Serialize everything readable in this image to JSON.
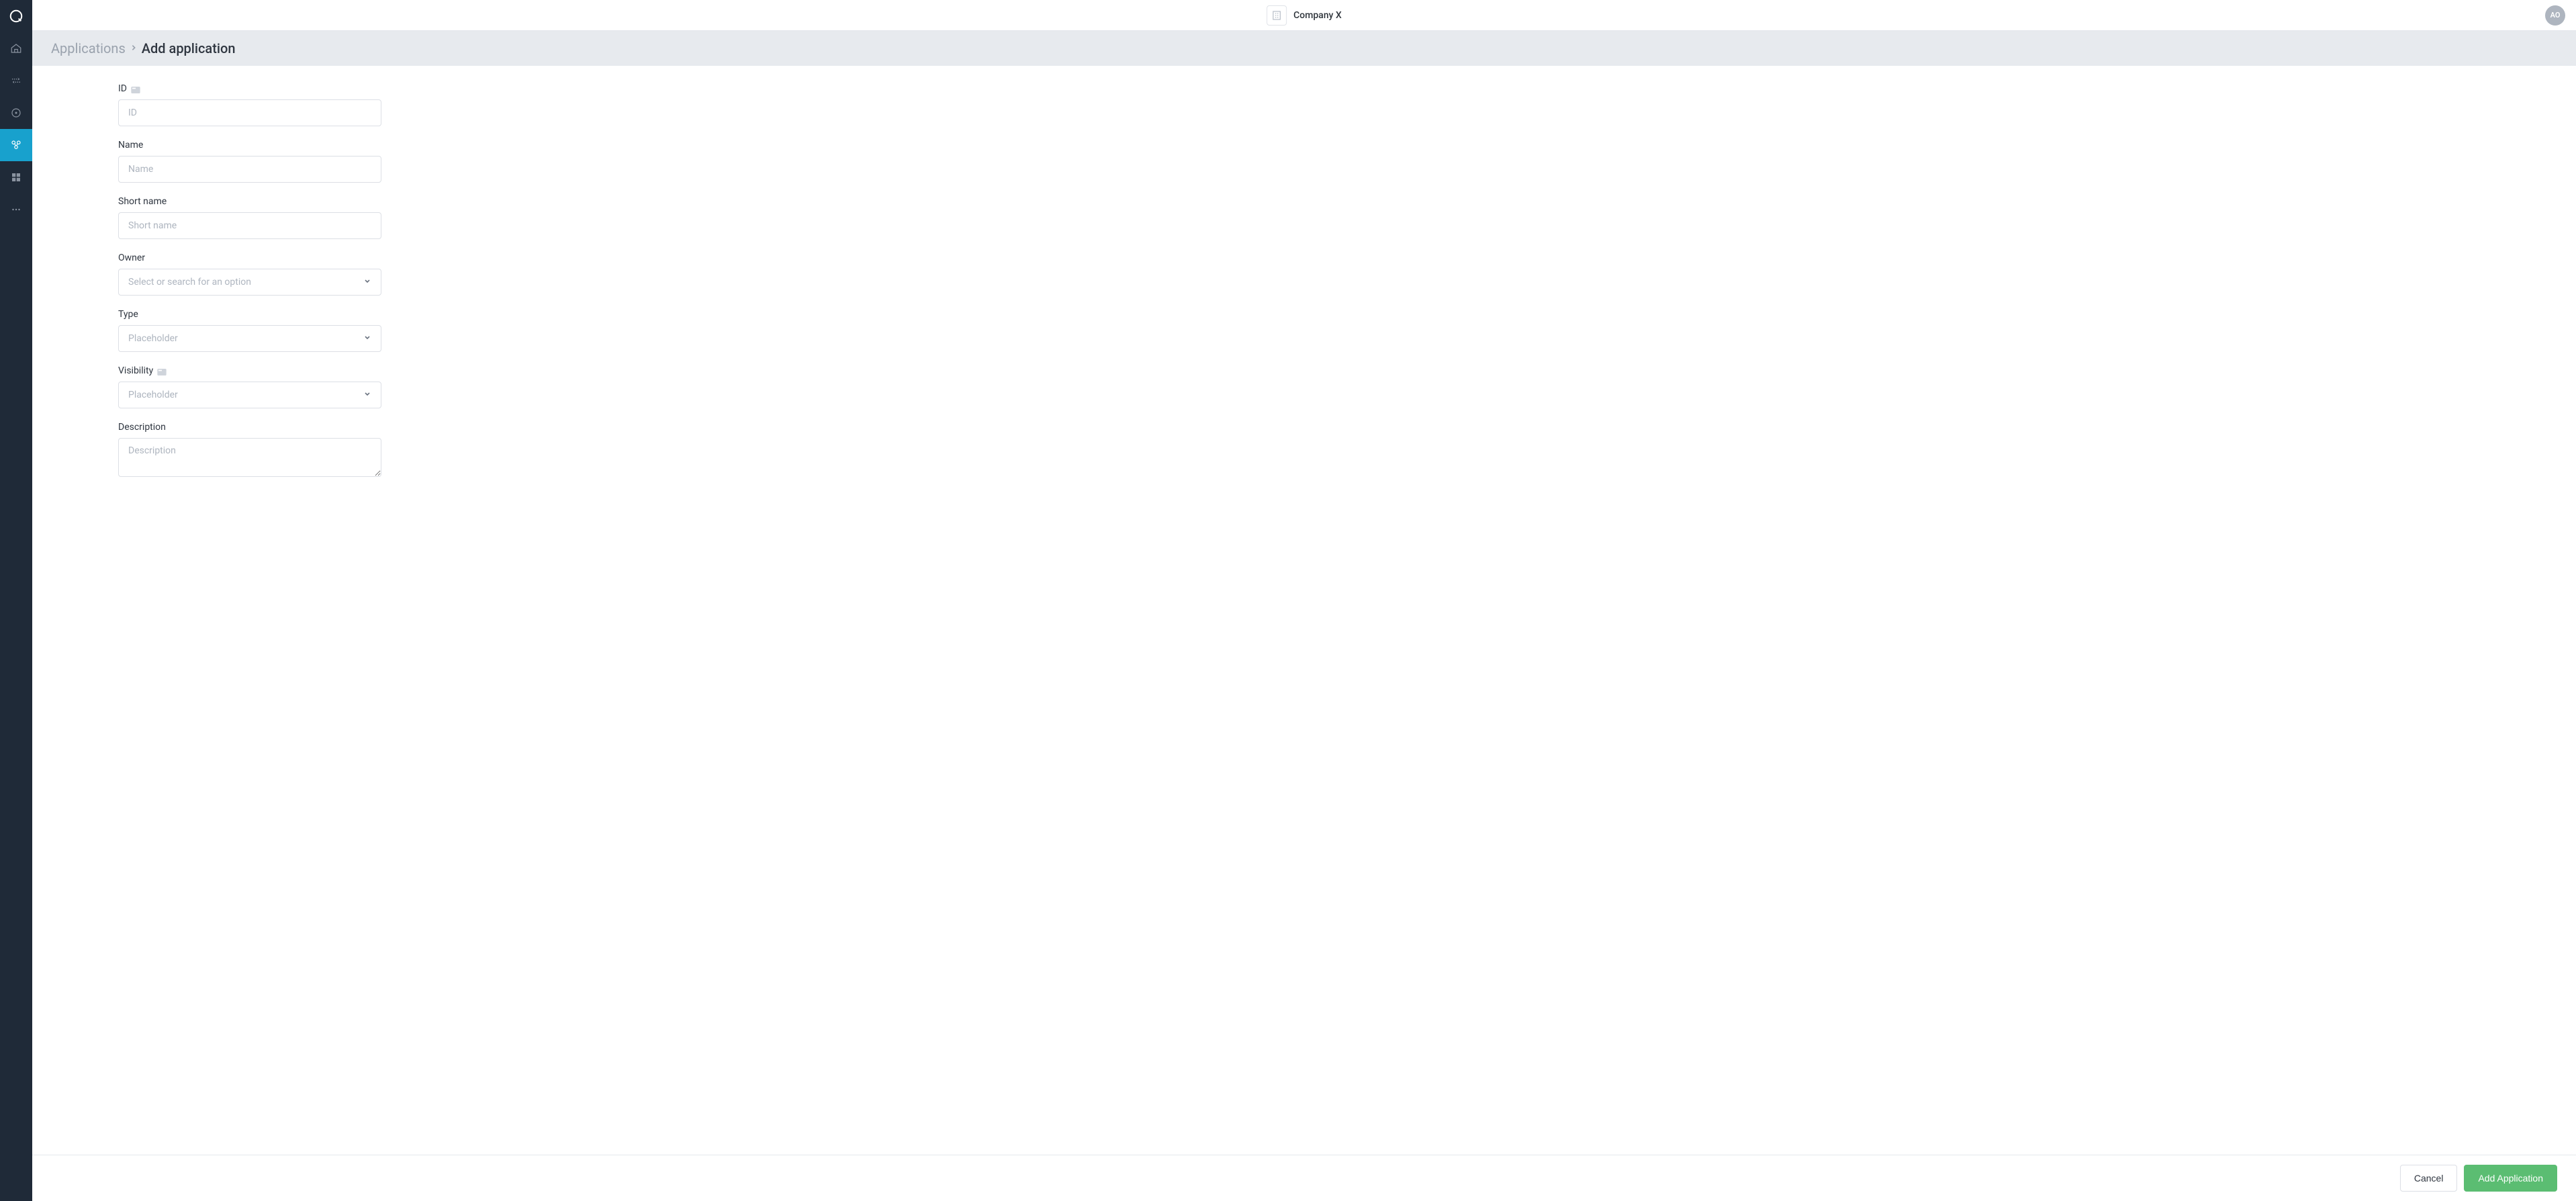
{
  "header": {
    "company_name": "Company X",
    "avatar_initials": "AO"
  },
  "breadcrumb": {
    "parent": "Applications",
    "current": "Add application"
  },
  "form": {
    "id": {
      "label": "ID",
      "placeholder": "ID"
    },
    "name": {
      "label": "Name",
      "placeholder": "Name"
    },
    "short_name": {
      "label": "Short name",
      "placeholder": "Short name"
    },
    "owner": {
      "label": "Owner",
      "placeholder": "Select or search for an option"
    },
    "type": {
      "label": "Type",
      "placeholder": "Placeholder"
    },
    "visibility": {
      "label": "Visibility",
      "placeholder": "Placeholder"
    },
    "description": {
      "label": "Description",
      "placeholder": "Description"
    }
  },
  "footer": {
    "cancel_label": "Cancel",
    "submit_label": "Add Application"
  },
  "sidebar": {
    "items": [
      {
        "name": "home"
      },
      {
        "name": "transfers"
      },
      {
        "name": "target"
      },
      {
        "name": "applications",
        "active": true
      },
      {
        "name": "dashboard"
      },
      {
        "name": "more"
      }
    ]
  }
}
